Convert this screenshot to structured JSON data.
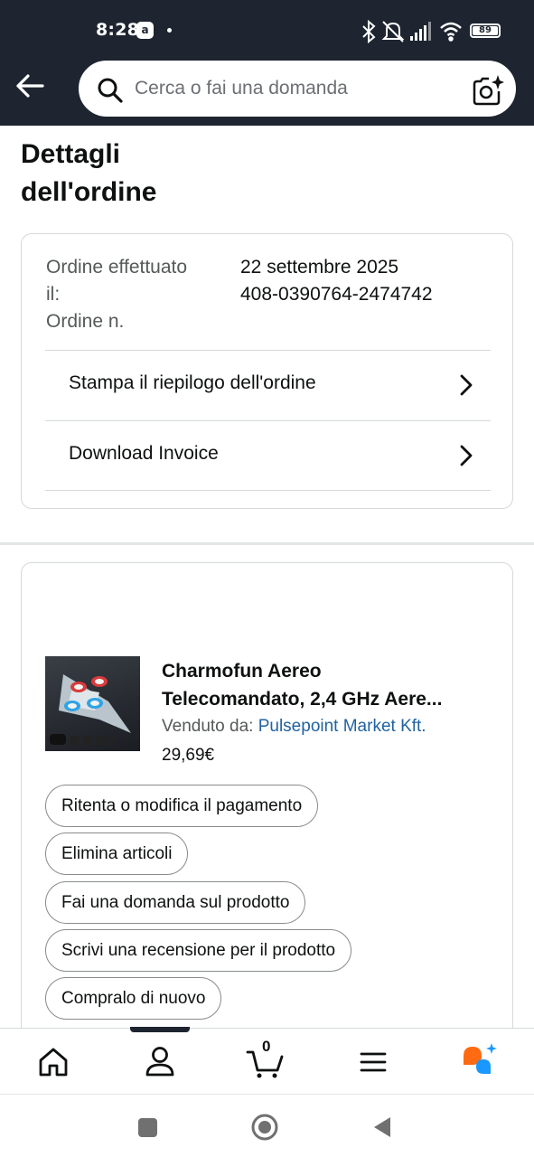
{
  "status_bar": {
    "time": "8:28",
    "app_badge": "a",
    "battery": "89"
  },
  "header": {
    "back_icon": "arrow-left-icon",
    "search_placeholder": "Cerca o fai una domanda",
    "camera_icon": "camera-sparkle-icon"
  },
  "page": {
    "title": "Dettagli dell'ordine"
  },
  "order": {
    "date_label": "Ordine effettuato il:",
    "number_label": "Ordine n.",
    "date_value": "22 settembre 2025",
    "number_value": "408-0390764-2474742",
    "actions": [
      {
        "label": "Stampa il riepilogo dell'ordine"
      },
      {
        "label": "Download Invoice"
      }
    ]
  },
  "product": {
    "title_line1": "Charmofun Aereo",
    "title_line2": "Telecomandato, 2,4 GHz Aere...",
    "sold_by_label": "Venduto da: ",
    "seller": "Pulsepoint Market Kft.",
    "price": "29,69€",
    "actions": [
      {
        "label": "Ritenta o modifica il pagamento"
      },
      {
        "label": "Elimina articoli"
      },
      {
        "label": "Fai una domanda sul prodotto"
      },
      {
        "label": "Scrivi una recensione per il prodotto"
      },
      {
        "label": "Compralo di nuovo"
      }
    ]
  },
  "bottom_nav": {
    "items": [
      "home-icon",
      "account-icon",
      "cart-icon",
      "menu-icon",
      "rufus-assistant-icon"
    ],
    "cart_count": "0",
    "active": "account-icon"
  },
  "colors": {
    "header_bg": "#1e2530",
    "link": "#2162a1",
    "assistant_orange": "#ff6a13",
    "assistant_blue": "#1a98ff"
  }
}
